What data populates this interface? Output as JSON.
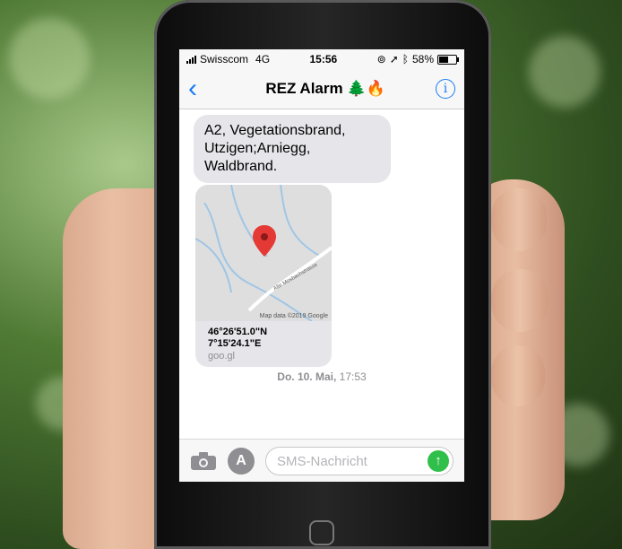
{
  "status_bar": {
    "carrier": "Swisscom",
    "network": "4G",
    "time": "15:56",
    "battery": "58%",
    "battery_level": 0.58,
    "icons": [
      "signal-icon",
      "lock-rotation-icon",
      "location-icon",
      "bluetooth-icon",
      "battery-icon"
    ]
  },
  "nav": {
    "back_icon": "chevron-left-icon",
    "title": "REZ Alarm 🌲🔥",
    "info_icon": "info-icon"
  },
  "messages": {
    "text": "A2, Vegetationsbrand, Utzigen;Arniegg, Waldbrand.",
    "map_card": {
      "credit": "Map data ©2019 Google",
      "road_label": "Alte Mosbachstrasse",
      "coord_lat": "46°26'51.0\"N",
      "coord_lon": "7°15'24.1\"E",
      "link": "goo.gl",
      "pin_color": "#e53935"
    },
    "timestamp_day": "Do. 10. Mai,",
    "timestamp_time": " 17:53"
  },
  "composer": {
    "camera_icon": "camera-icon",
    "appstore_icon": "app-store-icon",
    "placeholder": "SMS-Nachricht",
    "send_icon": "send-arrow-icon"
  },
  "colors": {
    "ios_blue": "#1a7cf5",
    "bubble_gray": "#e5e5ea",
    "send_green": "#2fbf4a"
  }
}
